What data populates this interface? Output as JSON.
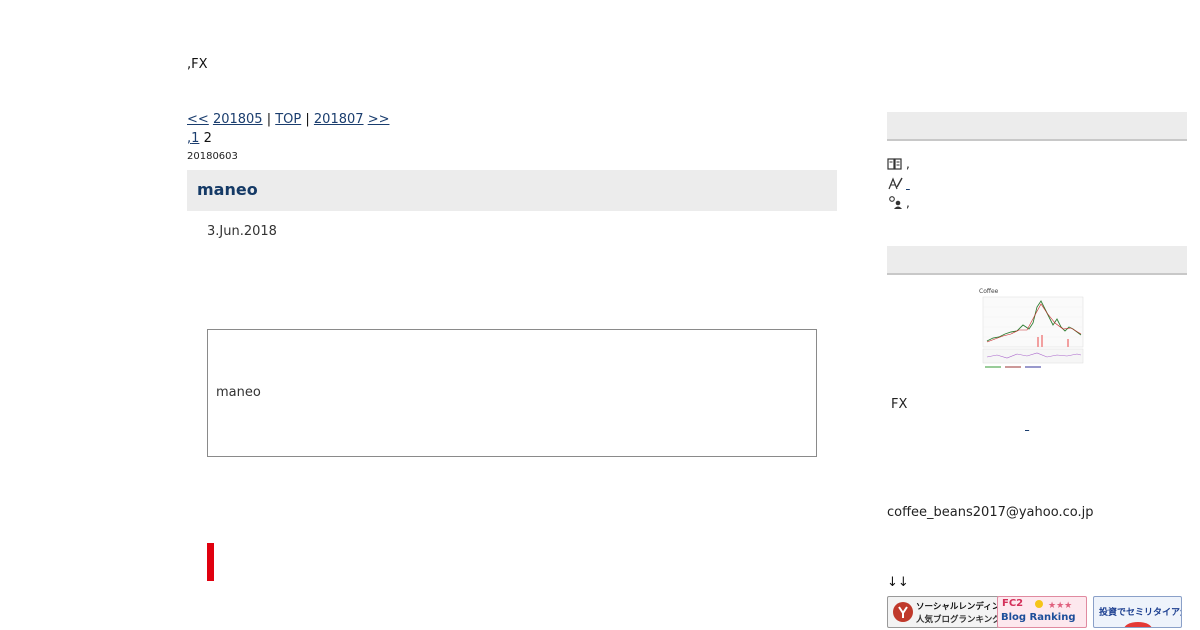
{
  "site": {
    "title": ",FX"
  },
  "month_nav": {
    "prev_arrow": "<<",
    "prev_month": "201805",
    "sep1": " | ",
    "top": "TOP",
    "sep2": " | ",
    "next_month": "201807",
    "next_arrow": ">>"
  },
  "pager": {
    "prefix": ",",
    "page1": "1",
    "page2": "2"
  },
  "post": {
    "date_code": "20180603",
    "title": "maneo",
    "date": "3.Jun.2018",
    "quote_text": "maneo"
  },
  "sidebar": {
    "profile_rows": [
      {
        "icon": "book-icon",
        "text": ","
      },
      {
        "icon": "writer-icon",
        "link": ""
      },
      {
        "icon": "people-icon",
        "text": ","
      }
    ],
    "chart_thumb": {
      "label": "Coffee"
    },
    "fx_label": "FX",
    "email": "coffee_beans2017@yahoo.co.jp",
    "arrows": "↓↓",
    "banners": [
      {
        "line1": "ソーシャルレンディング",
        "line2": "人気ブログランキング"
      },
      {
        "line1": "FC2",
        "line2": "Blog Ranking"
      },
      {
        "line1": "投資でセミリタイア生活"
      }
    ]
  },
  "colors": {
    "link": "#1a3d6e",
    "header_bg": "#ececec",
    "accent_red": "#e0000f"
  }
}
